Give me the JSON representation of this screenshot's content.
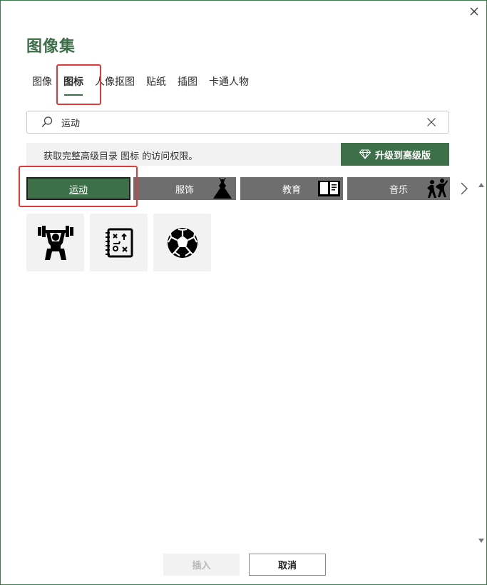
{
  "dialog": {
    "title": "图像集",
    "close_label": "✕"
  },
  "tabs": [
    {
      "label": "图像",
      "active": false
    },
    {
      "label": "图标",
      "active": true
    },
    {
      "label": "人像抠图",
      "active": false
    },
    {
      "label": "贴纸",
      "active": false
    },
    {
      "label": "插图",
      "active": false
    },
    {
      "label": "卡通人物",
      "active": false
    }
  ],
  "search": {
    "value": "运动",
    "placeholder": ""
  },
  "promo": {
    "text": "获取完整高级目录 图标 的访问权限。",
    "button_label": "升级到高级版"
  },
  "categories": [
    {
      "label": "运动",
      "active": true,
      "icon": ""
    },
    {
      "label": "服饰",
      "active": false,
      "icon": "dress-icon"
    },
    {
      "label": "教育",
      "active": false,
      "icon": "book-icon"
    },
    {
      "label": "音乐",
      "active": false,
      "icon": "dancers-icon"
    }
  ],
  "results": [
    {
      "icon": "weightlifter-icon"
    },
    {
      "icon": "play-strategy-icon"
    },
    {
      "icon": "soccer-ball-icon"
    }
  ],
  "footer": {
    "insert_label": "插入",
    "cancel_label": "取消"
  },
  "colors": {
    "accent": "#3d6f48",
    "highlight": "#e03a3a",
    "chip_inactive": "#6e6e6e"
  }
}
